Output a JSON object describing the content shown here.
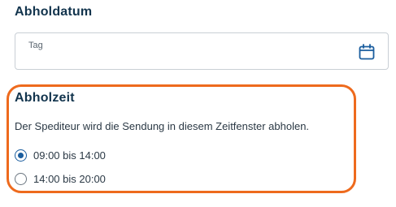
{
  "pickup_date": {
    "title": "Abholdatum",
    "field_label": "Tag",
    "field_value": "",
    "icon": "calendar-icon"
  },
  "pickup_time": {
    "title": "Abholzeit",
    "description": "Der Spediteur wird die Sendung in diesem Zeitfenster abholen.",
    "options": [
      {
        "label": "09:00 bis 14:00",
        "selected": true
      },
      {
        "label": "14:00 bis 20:00",
        "selected": false
      }
    ]
  },
  "colors": {
    "highlight_border": "#ee6a1d",
    "heading": "#12344d",
    "radio_selected": "#1a5d9e",
    "field_border": "#c9cfd5"
  }
}
